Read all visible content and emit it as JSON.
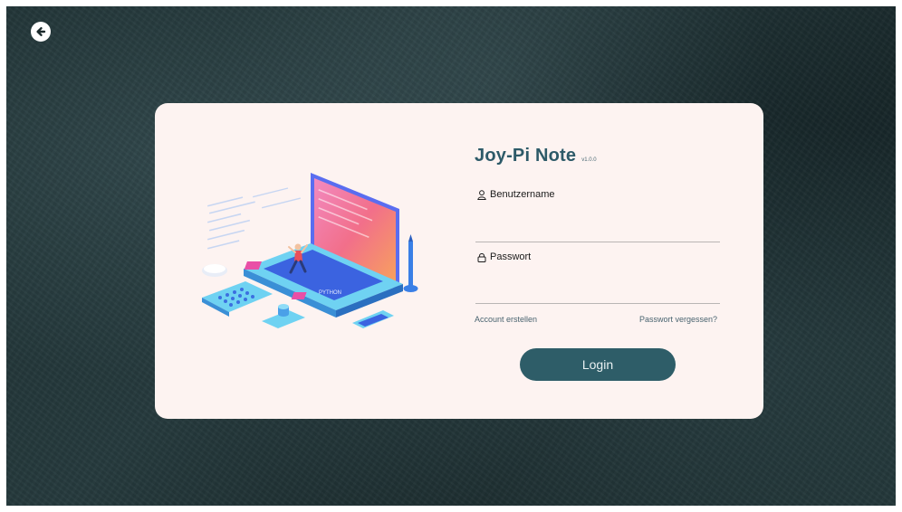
{
  "app": {
    "title": "Joy-Pi Note",
    "version": "v1.0.0"
  },
  "nav": {
    "back_icon": "arrow-left-circle-icon"
  },
  "form": {
    "username_label": "Benutzername",
    "username_icon": "user-icon",
    "username_value": "",
    "password_label": "Passwort",
    "password_icon": "lock-icon",
    "password_value": "",
    "create_account": "Account erstellen",
    "forgot_password": "Passwort vergessen?",
    "login_label": "Login"
  },
  "illustration": {
    "screen_label": "PYTHON",
    "icon": "laptop-programmer-illustration"
  },
  "colors": {
    "accent": "#2e5d68",
    "card_bg": "#fdf3f1",
    "title": "#2d5a68"
  }
}
